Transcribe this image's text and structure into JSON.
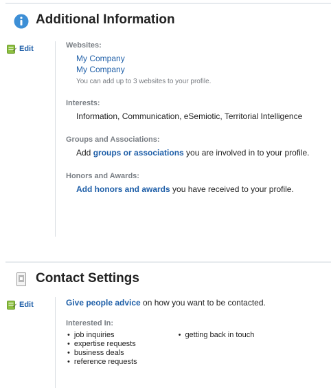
{
  "additional_info": {
    "title": "Additional Information",
    "edit_label": "Edit",
    "websites": {
      "label": "Websites:",
      "items": [
        "My Company",
        "My Company"
      ],
      "hint": "You can add up to 3 websites to your profile."
    },
    "interests": {
      "label": "Interests:",
      "text": "Information, Communication, eSemiotic, Territorial Intelligence"
    },
    "groups": {
      "label": "Groups and Associations:",
      "prefix": "Add ",
      "link": "groups or associations",
      "suffix": " you are involved in to your profile."
    },
    "honors": {
      "label": "Honors and Awards:",
      "link": "Add honors and awards",
      "suffix": " you have received to your profile."
    }
  },
  "contact_settings": {
    "title": "Contact Settings",
    "edit_label": "Edit",
    "advice_link": "Give people advice",
    "advice_suffix": " on how you want to be contacted.",
    "interested_label": "Interested In:",
    "left_items": [
      "job inquiries",
      "expertise requests",
      "business deals",
      "reference requests"
    ],
    "right_items": [
      "getting back in touch"
    ]
  },
  "icons": {
    "info": "info-icon",
    "edit": "edit-icon",
    "contact": "contact-card-icon"
  },
  "colors": {
    "link": "#1f5fa8",
    "info_icon": "#3d8fd6",
    "edit_icon": "#8cbf3f"
  }
}
